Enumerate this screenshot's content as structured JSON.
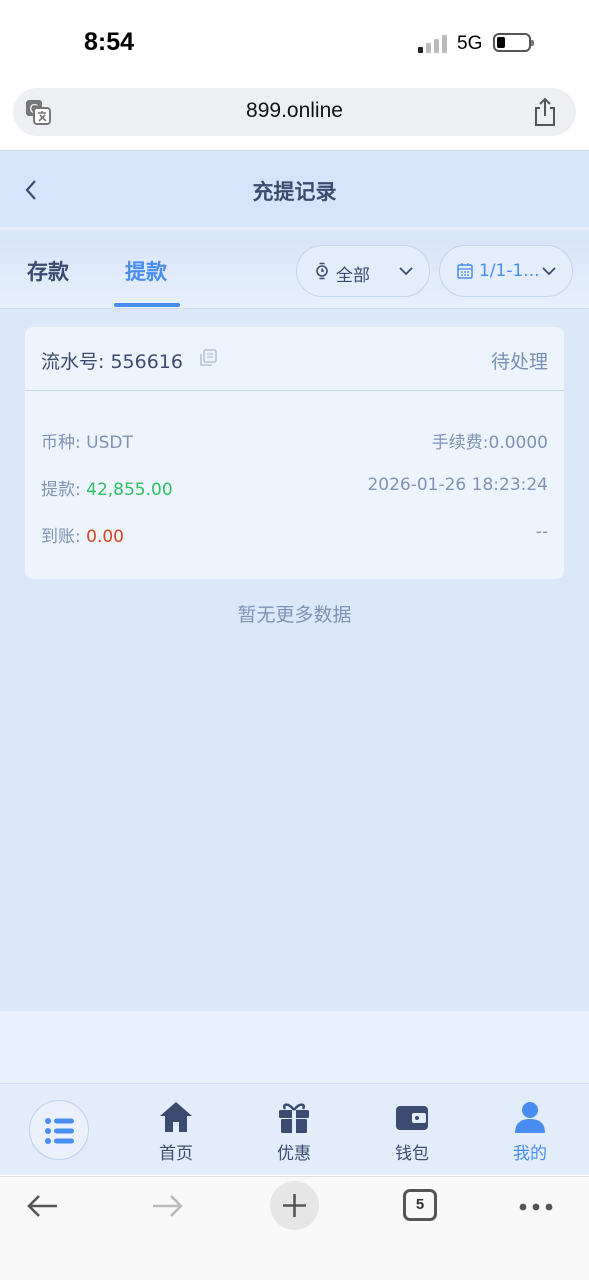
{
  "status_bar": {
    "time": "8:54",
    "network": "5G"
  },
  "browser": {
    "url": "899.online",
    "open_tabs": "5"
  },
  "header": {
    "title": "充提记录"
  },
  "tabs": [
    {
      "label": "存款",
      "active": false
    },
    {
      "label": "提款",
      "active": true
    }
  ],
  "filters": {
    "status": "全部",
    "date": "1/1-1..."
  },
  "record": {
    "serial_label": "流水号: 556616",
    "status": "待处理",
    "currency_label": "币种: ",
    "currency_value": "USDT",
    "fee": "手续费:0.0000",
    "withdraw_label": "提款: ",
    "withdraw_value": "42,855.00",
    "datetime": "2026-01-26 18:23:24",
    "received_label": "到账: ",
    "received_value": "0.00",
    "received_extra": "--"
  },
  "empty_text": "暂无更多数据",
  "nav": [
    {
      "label": "首页",
      "icon": "home-icon"
    },
    {
      "label": "优惠",
      "icon": "gift-icon"
    },
    {
      "label": "钱包",
      "icon": "wallet-icon"
    },
    {
      "label": "我的",
      "icon": "user-icon",
      "active": true
    }
  ],
  "colors": {
    "accent": "#4a8df0",
    "positive": "#2ec261",
    "negative": "#d7461e"
  }
}
